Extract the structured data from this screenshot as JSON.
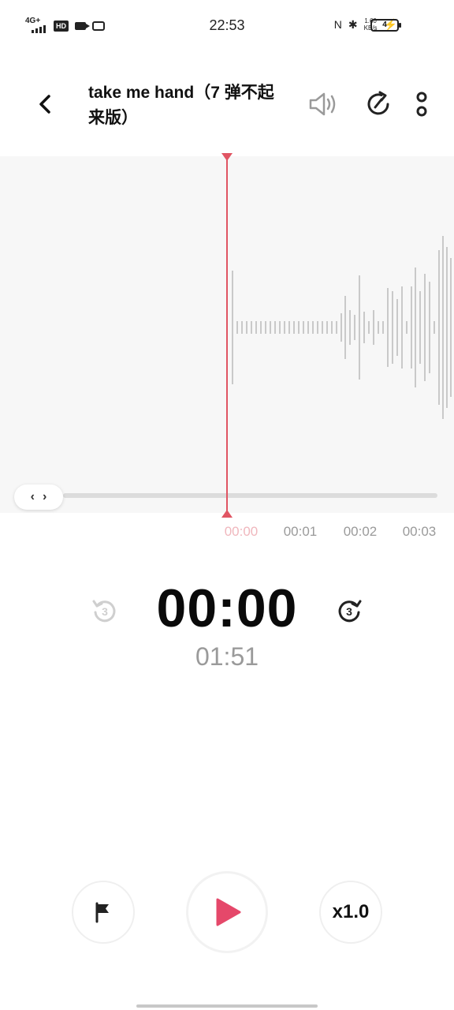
{
  "status_bar": {
    "network": "4G+",
    "hd": "HD",
    "time": "22:53",
    "speed_value": "1.60",
    "speed_unit": "KB/s",
    "battery": "4"
  },
  "header": {
    "title": "take me hand（7 弹不起来版）",
    "icons": [
      "back-icon",
      "volume-icon",
      "share-icon",
      "more-icon"
    ]
  },
  "waveform": {
    "ticks": [
      "00:00",
      "00:01",
      "00:02",
      "00:03"
    ],
    "accent_color": "#e05563"
  },
  "player": {
    "current_time": "00:00",
    "total_time": "01:51",
    "skip_back_seconds": "3",
    "skip_forward_seconds": "3",
    "speed": "x1.0"
  }
}
